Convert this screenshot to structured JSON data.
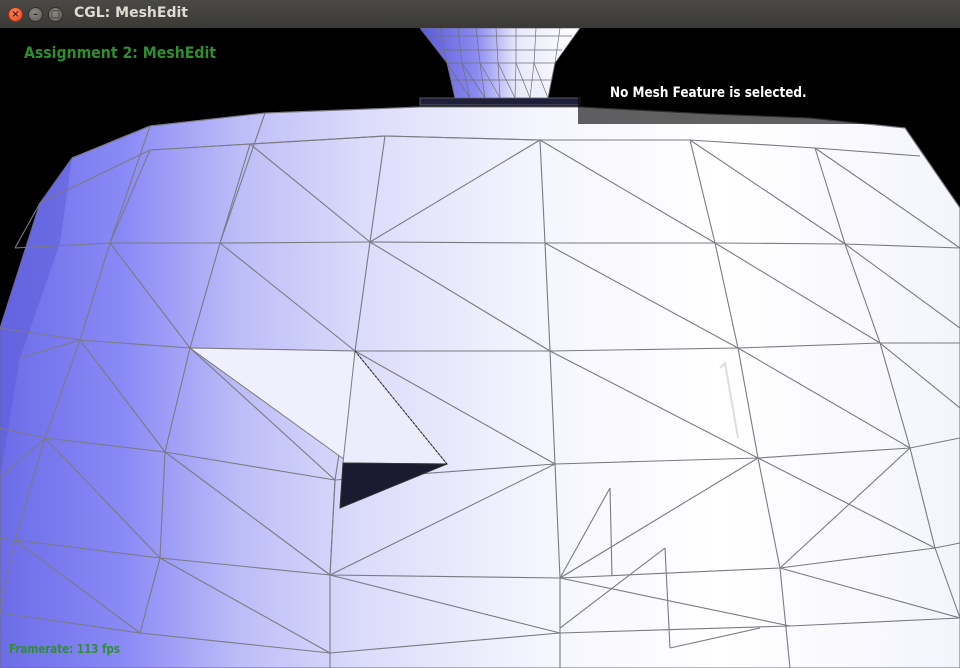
{
  "window": {
    "title": "CGL: MeshEdit",
    "close_icon": "close-icon",
    "minimize_icon": "minimize-icon",
    "maximize_icon": "maximize-icon"
  },
  "hud": {
    "title": "Assignment 2: MeshEdit",
    "status": "No Mesh Feature is selected.",
    "framerate": "Framerate: 113 fps"
  },
  "colors": {
    "hud_text": "#2f8f2f",
    "mesh_edge": "#7a7a84",
    "mesh_dark_face": "#1a1a30",
    "mesh_shade_dark": "#7070e8",
    "mesh_shade_light": "#ffffff"
  }
}
